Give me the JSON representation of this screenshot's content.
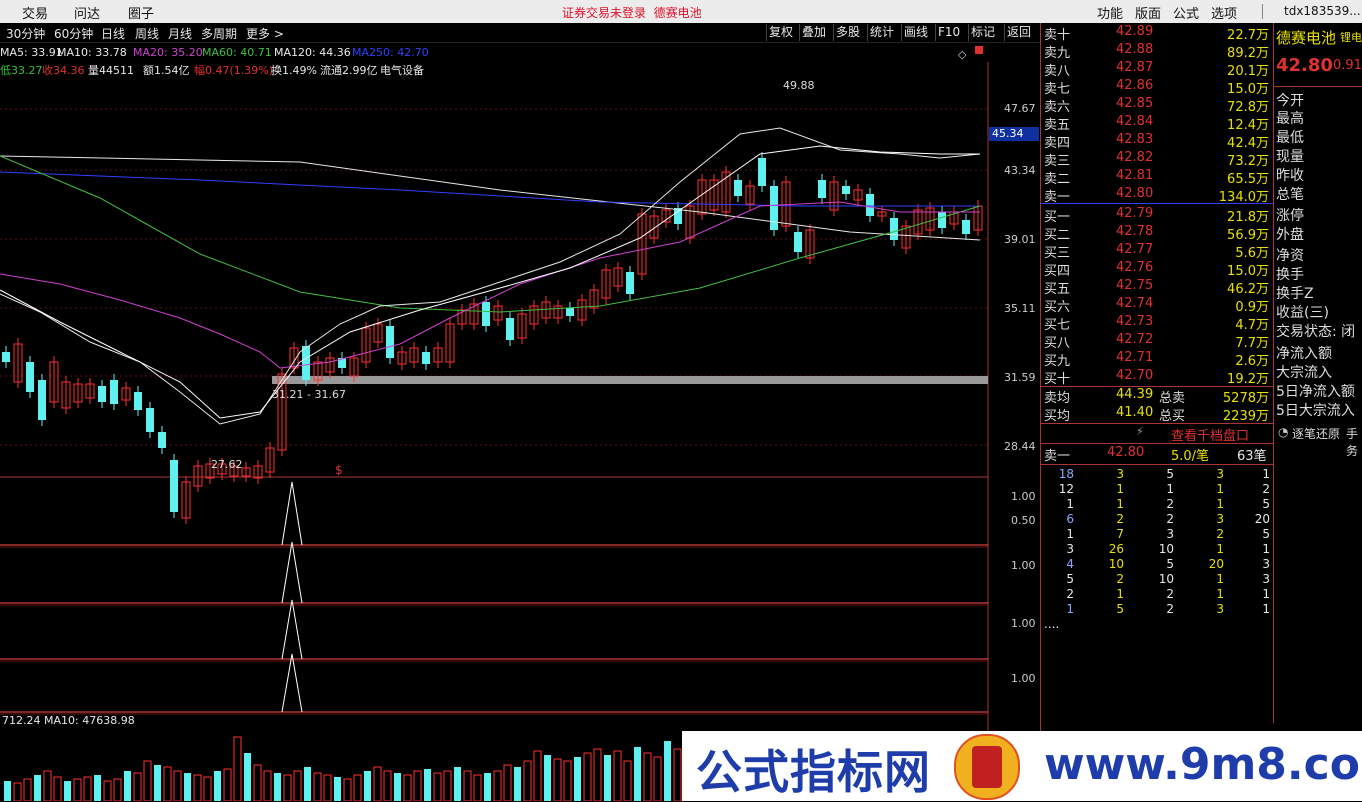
{
  "topbar": {
    "left_menu": [
      "交易",
      "问达",
      "圈子"
    ],
    "login_status": "证券交易未登录",
    "stock_name": "德赛电池",
    "right_menu": [
      "功能",
      "版面",
      "公式",
      "选项"
    ],
    "user": "tdx183539..."
  },
  "periods": [
    "30分钟",
    "60分钟",
    "日线",
    "周线",
    "月线",
    "多周期",
    "更多 >"
  ],
  "toolbar_buttons": [
    "复权",
    "叠加",
    "多股",
    "统计",
    "画线",
    "F10",
    "标记",
    "返回"
  ],
  "ma_line": [
    {
      "text": "MA5: 33.91",
      "color": "#e8e8e8"
    },
    {
      "text": "MA10: 33.78",
      "color": "#e8e8e8"
    },
    {
      "text": "MA20: 35.20",
      "color": "#d040d0"
    },
    {
      "text": "MA60: 40.71",
      "color": "#40c040"
    },
    {
      "text": "MA120: 44.36",
      "color": "#e8e8e8"
    },
    {
      "text": "MA250: 42.70",
      "color": "#3040ff"
    }
  ],
  "quote_line": [
    {
      "text": "低33.27",
      "color": "#30c030"
    },
    {
      "text": "收34.36",
      "color": "#e03030"
    },
    {
      "text": "量44511",
      "color": "#e8e8e8"
    },
    {
      "text": "额1.54亿",
      "color": "#e8e8e8"
    },
    {
      "text": "幅0.47(1.39%)",
      "color": "#e03030"
    },
    {
      "text": "换1.49%",
      "color": "#e8e8e8"
    },
    {
      "text": "流通2.99亿",
      "color": "#e8e8e8"
    },
    {
      "text": "电气设备",
      "color": "#e8e8e8"
    }
  ],
  "price_axis": [
    "47.67",
    "43.34",
    "39.01",
    "35.11",
    "31.59",
    "28.44"
  ],
  "current_price_tag": "45.34",
  "annotations": {
    "high": "49.88",
    "low": "27.62",
    "range": "31.21 - 31.67",
    "marker": "$"
  },
  "indicator_axis": [
    [
      "1.00",
      "0.50"
    ],
    [
      "1.00"
    ],
    [
      "1.00"
    ],
    [
      "1.00"
    ]
  ],
  "volume_line": "712.24  MA10: 47638.98",
  "orderbook": {
    "asks": [
      {
        "label": "卖十",
        "price": "42.89",
        "vol": "22.7万"
      },
      {
        "label": "卖九",
        "price": "42.88",
        "vol": "89.2万"
      },
      {
        "label": "卖八",
        "price": "42.87",
        "vol": "20.1万"
      },
      {
        "label": "卖七",
        "price": "42.86",
        "vol": "15.0万"
      },
      {
        "label": "卖六",
        "price": "42.85",
        "vol": "72.8万"
      },
      {
        "label": "卖五",
        "price": "42.84",
        "vol": "12.4万"
      },
      {
        "label": "卖四",
        "price": "42.83",
        "vol": "42.4万"
      },
      {
        "label": "卖三",
        "price": "42.82",
        "vol": "73.2万"
      },
      {
        "label": "卖二",
        "price": "42.81",
        "vol": "65.5万"
      },
      {
        "label": "卖一",
        "price": "42.80",
        "vol": "134.0万"
      }
    ],
    "bids": [
      {
        "label": "买一",
        "price": "42.79",
        "vol": "21.8万"
      },
      {
        "label": "买二",
        "price": "42.78",
        "vol": "56.9万"
      },
      {
        "label": "买三",
        "price": "42.77",
        "vol": "5.6万"
      },
      {
        "label": "买四",
        "price": "42.76",
        "vol": "15.0万"
      },
      {
        "label": "买五",
        "price": "42.75",
        "vol": "46.2万"
      },
      {
        "label": "买六",
        "price": "42.74",
        "vol": "0.9万"
      },
      {
        "label": "买七",
        "price": "42.73",
        "vol": "4.7万"
      },
      {
        "label": "买八",
        "price": "42.72",
        "vol": "7.7万"
      },
      {
        "label": "买九",
        "price": "42.71",
        "vol": "2.6万"
      },
      {
        "label": "买十",
        "price": "42.70",
        "vol": "19.2万"
      }
    ],
    "sell_avg": {
      "label": "卖均",
      "price": "44.39",
      "tlabel": "总卖",
      "total": "5278万"
    },
    "buy_avg": {
      "label": "买均",
      "price": "41.40",
      "tlabel": "总买",
      "total": "2239万"
    },
    "view_ten": "查看千档盘口",
    "sell1_detail": {
      "label": "卖一",
      "price": "42.80",
      "vol": "5.0/笔",
      "count": "63笔"
    }
  },
  "ticks": [
    [
      "18",
      "3",
      "5",
      "3",
      "1"
    ],
    [
      "12",
      "1",
      "1",
      "1",
      "2"
    ],
    [
      "1",
      "1",
      "2",
      "1",
      "5"
    ],
    [
      "6",
      "2",
      "2",
      "3",
      "20"
    ],
    [
      "1",
      "7",
      "3",
      "2",
      "5"
    ],
    [
      "3",
      "26",
      "10",
      "1",
      "1"
    ],
    [
      "4",
      "10",
      "5",
      "20",
      "3"
    ],
    [
      "5",
      "2",
      "10",
      "1",
      "3"
    ],
    [
      "2",
      "1",
      "2",
      "1",
      "1"
    ],
    [
      "1",
      "5",
      "2",
      "3",
      "1"
    ],
    [
      "....",
      "",
      "",
      "",
      ""
    ]
  ],
  "stock_panel": {
    "name": "德赛电池",
    "tag": "锂电",
    "price": "42.80",
    "change": "0.91",
    "fields": [
      "今开",
      "最高",
      "最低",
      "现量",
      "昨收",
      "总笔",
      "涨停",
      "外盘",
      "净资",
      "换手",
      "换手Z",
      "收益(三)",
      "交易状态: 闭",
      "净流入额",
      "大宗流入",
      "5日净流入额",
      "5日大宗流入"
    ],
    "replay": "逐笔还原",
    "replay2": "手务"
  },
  "watermark": {
    "text": "公式指标网",
    "url": "www.9m8.com"
  }
}
